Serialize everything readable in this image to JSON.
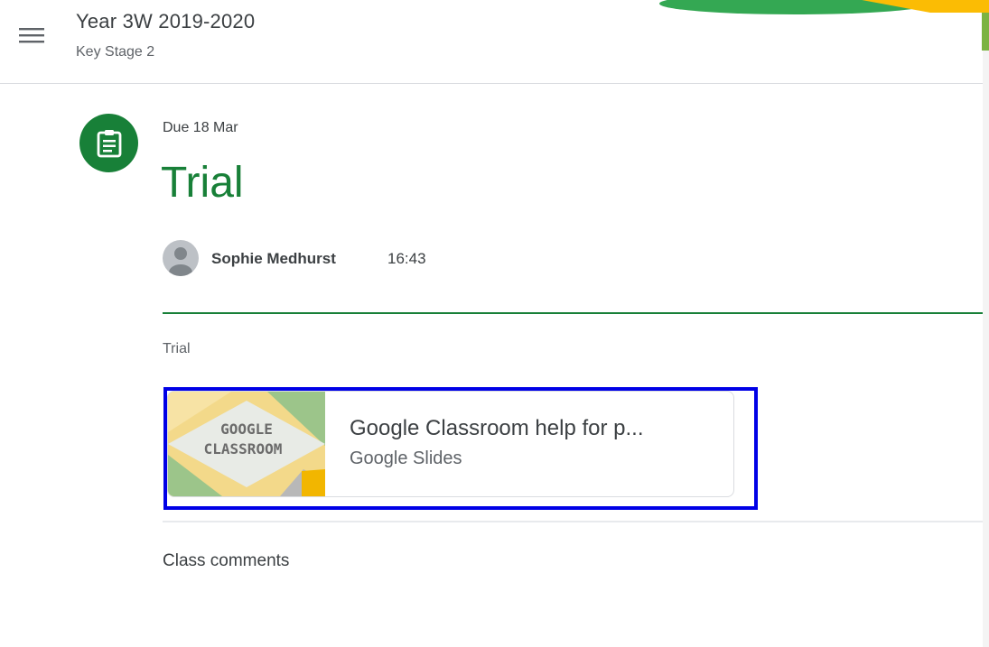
{
  "header": {
    "course_title": "Year 3W 2019-2020",
    "course_subtitle": "Key Stage 2",
    "menu_icon": "hamburger-menu-icon"
  },
  "assignment": {
    "icon": "assignment-clipboard-icon",
    "due": "Due 18 Mar",
    "title": "Trial",
    "author": "Sophie Medhurst",
    "time": "16:43",
    "description": "Trial"
  },
  "attachment": {
    "thumbnail_text_line1": "GOOGLE",
    "thumbnail_text_line2": "CLASSROOM",
    "title": "Google Classroom help for p...",
    "type": "Google Slides"
  },
  "comments": {
    "label": "Class comments"
  },
  "colors": {
    "accent_green": "#188038",
    "highlight_blue": "#0000e6",
    "text_primary": "#3c4043",
    "text_secondary": "#5f6368"
  }
}
